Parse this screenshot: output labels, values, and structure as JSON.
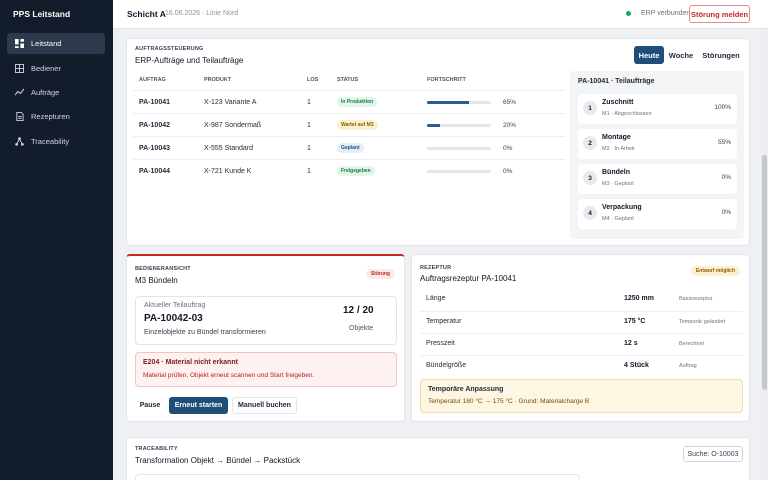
{
  "sidebar": {
    "brand": "PPS Leitstand",
    "items": [
      {
        "label": "Leitstand",
        "icon": "dashboard-icon",
        "active": true
      },
      {
        "label": "Bediener",
        "icon": "operator-icon",
        "active": false
      },
      {
        "label": "Aufträge",
        "icon": "orders-icon",
        "active": false
      },
      {
        "label": "Rezepturen",
        "icon": "recipe-icon",
        "active": false
      },
      {
        "label": "Traceability",
        "icon": "traceability-icon",
        "active": false
      }
    ]
  },
  "topbar": {
    "shift": "Schicht A",
    "meta": "16.06.2026 · Linie Nord",
    "erp_status": "ERP verbunden",
    "status_color": "#22a55b",
    "alarm_button": "Störung melden"
  },
  "erp": {
    "label": "AUFTRAGSSTEUERUNG",
    "title": "ERP-Aufträge und Teilaufträge",
    "tabs": [
      "Heute",
      "Woche",
      "Störungen"
    ],
    "columns": [
      "AUFTRAG",
      "PRODUKT",
      "LOS",
      "STATUS",
      "FORTSCHRITT"
    ],
    "rows": [
      {
        "id": "PA-10041",
        "product": "X-123 Variante A",
        "los": "1",
        "status": "In Produktion",
        "status_kind": "green",
        "progress": 65,
        "progress_label": "65%"
      },
      {
        "id": "PA-10042",
        "product": "X-987 Sondermaß",
        "los": "1",
        "status": "Wartet auf M3",
        "status_kind": "yellow",
        "progress": 20,
        "progress_label": "20%"
      },
      {
        "id": "PA-10043",
        "product": "X-555 Standard",
        "los": "1",
        "status": "Geplant",
        "status_kind": "blue",
        "progress": 0,
        "progress_label": "0%"
      },
      {
        "id": "PA-10044",
        "product": "X-721 Kunde K",
        "los": "1",
        "status": "Freigegeben",
        "status_kind": "green",
        "progress": 0,
        "progress_label": "0%"
      }
    ],
    "subtasks_title": "PA-10041 · Teilaufträge",
    "subtasks": [
      {
        "num": "1",
        "name": "Zuschnitt",
        "sub": "M1 · Abgeschlossen",
        "pct": "100%"
      },
      {
        "num": "2",
        "name": "Montage",
        "sub": "M2 · In Arbeit",
        "pct": "55%"
      },
      {
        "num": "3",
        "name": "Bündeln",
        "sub": "M3 · Geplant",
        "pct": "0%"
      },
      {
        "num": "4",
        "name": "Verpackung",
        "sub": "M4 · Geplant",
        "pct": "0%"
      }
    ]
  },
  "operator": {
    "label": "BEDIENERANSICHT",
    "title": "M3 Bündeln",
    "badge": "Störung",
    "current_label": "Aktueller Teilauftrag",
    "current_id": "PA-10042-03",
    "current_desc": "Einzelobjekte zu Bündel transformieren",
    "count": "12 / 20",
    "count_label": "Objekte",
    "error_title": "E204 · Material nicht erkannt",
    "error_text": "Material prüfen, Objekt erneut scannen und Start freigeben.",
    "buttons": {
      "pause": "Pause",
      "restart": "Erneut starten",
      "manual": "Manuell buchen"
    }
  },
  "recipe": {
    "label": "REZEPTUR",
    "title": "Auftragsrezeptur PA-10041",
    "badge": "Entwurf möglich",
    "params": [
      {
        "name": "Länge",
        "value": "1250 mm",
        "note": "Basisrezeptur"
      },
      {
        "name": "Temperatur",
        "value": "175 °C",
        "note": "Temporär geändert"
      },
      {
        "name": "Presszeit",
        "value": "12 s",
        "note": "Berechnet"
      },
      {
        "name": "Bündelgröße",
        "value": "4 Stück",
        "note": "Auftrag"
      }
    ],
    "temp_title": "Temporäre Anpassung",
    "temp_text": "Temperatur 180 °C → 175 °C · Grund: Materialcharge B"
  },
  "trace": {
    "label": "TRACEABILITY",
    "title": "Transformation Objekt → Bündel → Packstück",
    "search": "Suche: O-10003"
  }
}
